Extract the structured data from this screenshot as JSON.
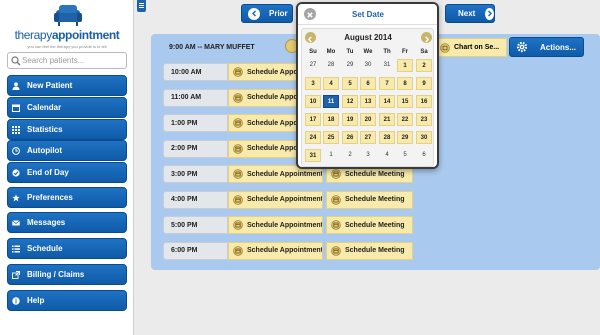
{
  "logo": {
    "brand_part1": "therapy",
    "brand_part2": "appointment",
    "tagline": "you can feel the therapy you provide is to tell"
  },
  "search": {
    "placeholder": "Search patients..."
  },
  "sidebar": {
    "items": [
      {
        "label": "New Patient",
        "icon": "user-icon"
      },
      {
        "label": "Calendar",
        "icon": "calendar-icon"
      },
      {
        "label": "Statistics",
        "icon": "grid-icon"
      },
      {
        "label": "Autopilot",
        "icon": "clock-icon"
      },
      {
        "label": "End of Day",
        "icon": "check-icon"
      },
      {
        "label": "Preferences",
        "icon": "star-icon"
      },
      {
        "label": "Messages",
        "icon": "envelope-icon"
      },
      {
        "label": "Schedule",
        "icon": "list-icon"
      },
      {
        "label": "Billing / Claims",
        "icon": "external-link-icon"
      },
      {
        "label": "Help",
        "icon": "info-icon"
      }
    ]
  },
  "topnav": {
    "prior_label": "Prior",
    "next_label": "Next"
  },
  "datepicker": {
    "title": "Set Date",
    "month": "August 2014",
    "dow": [
      "Su",
      "Mo",
      "Tu",
      "We",
      "Th",
      "Fr",
      "Sa"
    ],
    "weeks": [
      [
        "27",
        "28",
        "29",
        "30",
        "31",
        "1",
        "2"
      ],
      [
        "3",
        "4",
        "5",
        "6",
        "7",
        "8",
        "9"
      ],
      [
        "10",
        "11",
        "12",
        "13",
        "14",
        "15",
        "16"
      ],
      [
        "17",
        "18",
        "19",
        "20",
        "21",
        "22",
        "23"
      ],
      [
        "24",
        "25",
        "26",
        "27",
        "28",
        "29",
        "30"
      ],
      [
        "31",
        "1",
        "2",
        "3",
        "4",
        "5",
        "6"
      ]
    ],
    "selected": "11"
  },
  "schedule": {
    "patient": "9:00 AM -- MARY MUFFET",
    "chart_label": "Chart on Se...",
    "actions_label": "Actions...",
    "slots": [
      {
        "time": "10:00 AM",
        "appt": "Schedule Appointment",
        "meeting": ""
      },
      {
        "time": "11:00 AM",
        "appt": "Schedule Appointment",
        "meeting": ""
      },
      {
        "time": "1:00 PM",
        "appt": "Schedule Appointment",
        "meeting": ""
      },
      {
        "time": "2:00 PM",
        "appt": "Schedule Appointment",
        "meeting": ""
      },
      {
        "time": "3:00 PM",
        "appt": "Schedule Appointment",
        "meeting": "Schedule Meeting"
      },
      {
        "time": "4:00 PM",
        "appt": "Schedule Appointment",
        "meeting": "Schedule Meeting"
      },
      {
        "time": "5:00 PM",
        "appt": "Schedule Appointment",
        "meeting": "Schedule Meeting"
      },
      {
        "time": "6:00 PM",
        "appt": "Schedule Appointment",
        "meeting": "Schedule Meeting"
      }
    ]
  },
  "colors": {
    "accent": "#1f62a8",
    "slot": "#f7eaaa",
    "panel": "#a9c9ee"
  }
}
